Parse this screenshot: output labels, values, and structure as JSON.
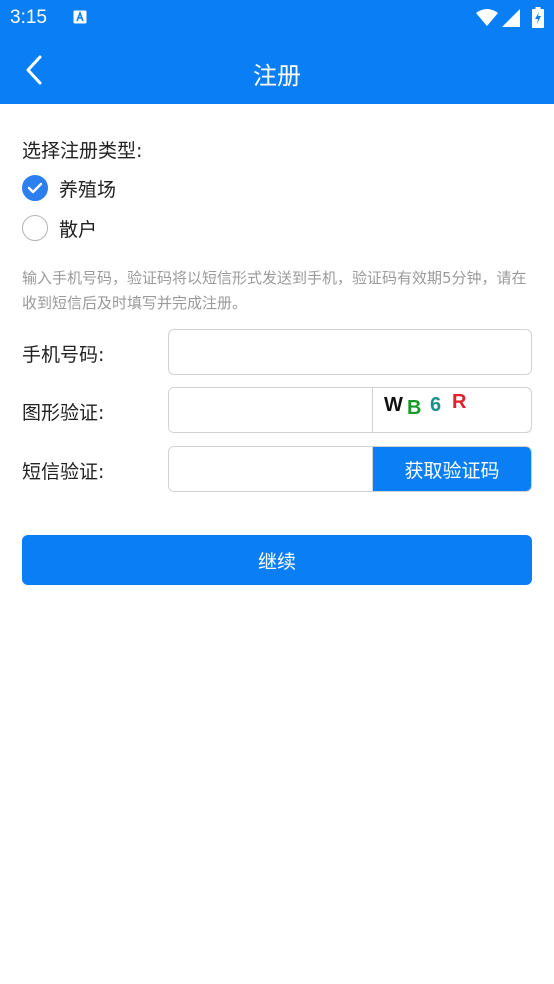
{
  "status_bar": {
    "time": "3:15",
    "icons": [
      "notification-a-icon",
      "wifi-icon",
      "signal-icon",
      "battery-charging-icon"
    ]
  },
  "app_bar": {
    "title": "注册",
    "back_icon": "chevron-left-icon"
  },
  "registration_type": {
    "label": "选择注册类型:",
    "options": [
      {
        "label": "养殖场",
        "checked": true
      },
      {
        "label": "散户",
        "checked": false
      }
    ]
  },
  "hint": "输入手机号码，验证码将以短信形式发送到手机，验证码有效期5分钟，请在收到短信后及时填写并完成注册。",
  "fields": {
    "phone": {
      "label": "手机号码:",
      "value": "",
      "placeholder": ""
    },
    "captcha": {
      "label": "图形验证:",
      "value": "",
      "placeholder": "",
      "code": [
        "W",
        "B",
        "6",
        "R"
      ],
      "code_colors": [
        "#111111",
        "#1a9a2a",
        "#1a8f8f",
        "#e0202a"
      ]
    },
    "sms": {
      "label": "短信验证:",
      "value": "",
      "placeholder": "",
      "button_label": "获取验证码"
    }
  },
  "continue_button": "继续",
  "colors": {
    "primary": "#0a7ef5",
    "hint_text": "#9a9a9a",
    "border": "#d2d2d2"
  }
}
